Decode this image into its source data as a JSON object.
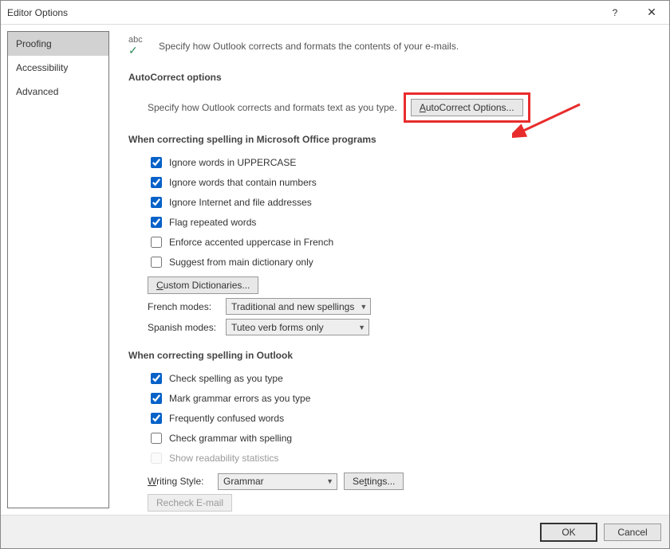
{
  "window": {
    "title": "Editor Options"
  },
  "sidebar": {
    "tabs": [
      {
        "label": "Proofing",
        "selected": true
      },
      {
        "label": "Accessibility",
        "selected": false
      },
      {
        "label": "Advanced",
        "selected": false
      }
    ]
  },
  "intro": {
    "text": "Specify how Outlook corrects and formats the contents of your e-mails."
  },
  "autocorrect": {
    "heading": "AutoCorrect options",
    "desc": "Specify how Outlook corrects and formats text as you type.",
    "button": "AutoCorrect Options..."
  },
  "spelling_office": {
    "heading": "When correcting spelling in Microsoft Office programs",
    "items": [
      {
        "label": "Ignore words in UPPERCASE",
        "checked": true,
        "mn": "U"
      },
      {
        "label": "Ignore words that contain numbers",
        "checked": true,
        "mn": "b"
      },
      {
        "label": "Ignore Internet and file addresses",
        "checked": true,
        "mn": "f"
      },
      {
        "label": "Flag repeated words",
        "checked": true,
        "mn": "R"
      },
      {
        "label": "Enforce accented uppercase in French",
        "checked": false,
        "mn": ""
      },
      {
        "label": "Suggest from main dictionary only",
        "checked": false,
        "mn": ""
      }
    ],
    "custom_dict_button": "Custom Dictionaries...",
    "french": {
      "label": "French modes:",
      "value": "Traditional and new spellings"
    },
    "spanish": {
      "label": "Spanish modes:",
      "value": "Tuteo verb forms only"
    }
  },
  "spelling_outlook": {
    "heading": "When correcting spelling in Outlook",
    "items": [
      {
        "label": "Check spelling as you type",
        "checked": true
      },
      {
        "label": "Mark grammar errors as you type",
        "checked": true
      },
      {
        "label": "Frequently confused words",
        "checked": true
      },
      {
        "label": "Check grammar with spelling",
        "checked": false
      },
      {
        "label": "Show readability statistics",
        "checked": false,
        "disabled": true
      }
    ],
    "writing_style": {
      "label": "Writing Style:",
      "value": "Grammar",
      "settings_button": "Settings..."
    },
    "recheck_button": "Recheck E-mail"
  },
  "footer": {
    "ok": "OK",
    "cancel": "Cancel"
  }
}
